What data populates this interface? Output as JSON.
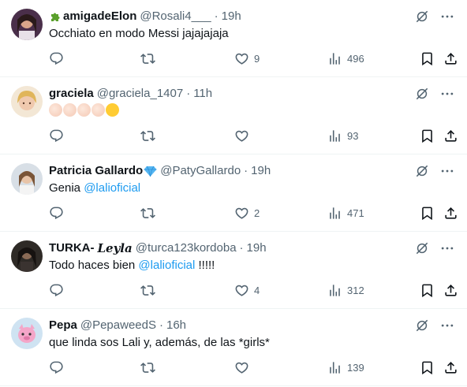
{
  "colors": {
    "text": "#0f1419",
    "secondary": "#536471",
    "link": "#1d9bf0",
    "divider": "#eff3f4"
  },
  "replies": [
    {
      "name": "amigadeElon",
      "handle": "@Rosali4___",
      "time": "19h",
      "badge_icon": "puzzle-piece-icon",
      "text": "Occhiato en modo Messi jajajajaja",
      "likes": "9",
      "views": "496"
    },
    {
      "name": "graciela",
      "handle": "@graciela_1407",
      "time": "11h",
      "emojis": [
        "clapping-hands-icon",
        "clapping-hands-icon",
        "clapping-hands-icon",
        "clapping-hands-icon",
        "grinning-face-icon"
      ],
      "likes": "",
      "views": "93"
    },
    {
      "name": "Patricia Gallardo",
      "handle": "@PatyGallardo",
      "time": "19h",
      "badge_icon": "gem-icon",
      "text": "Genia",
      "mention": "@lalioficial",
      "likes": "2",
      "views": "471"
    },
    {
      "name": "TURKA-",
      "name_cursive": "Leyla",
      "handle": "@turca123kordoba",
      "time": "19h",
      "text": "Todo haces bien",
      "mention": "@lalioficial",
      "suffix": "!!!!!",
      "likes": "4",
      "views": "312"
    },
    {
      "name": "Pepa",
      "handle": "@PepaweedS",
      "time": "16h",
      "text": "que linda sos Lali y, además, de las *girls*",
      "likes": "",
      "views": "139"
    }
  ]
}
